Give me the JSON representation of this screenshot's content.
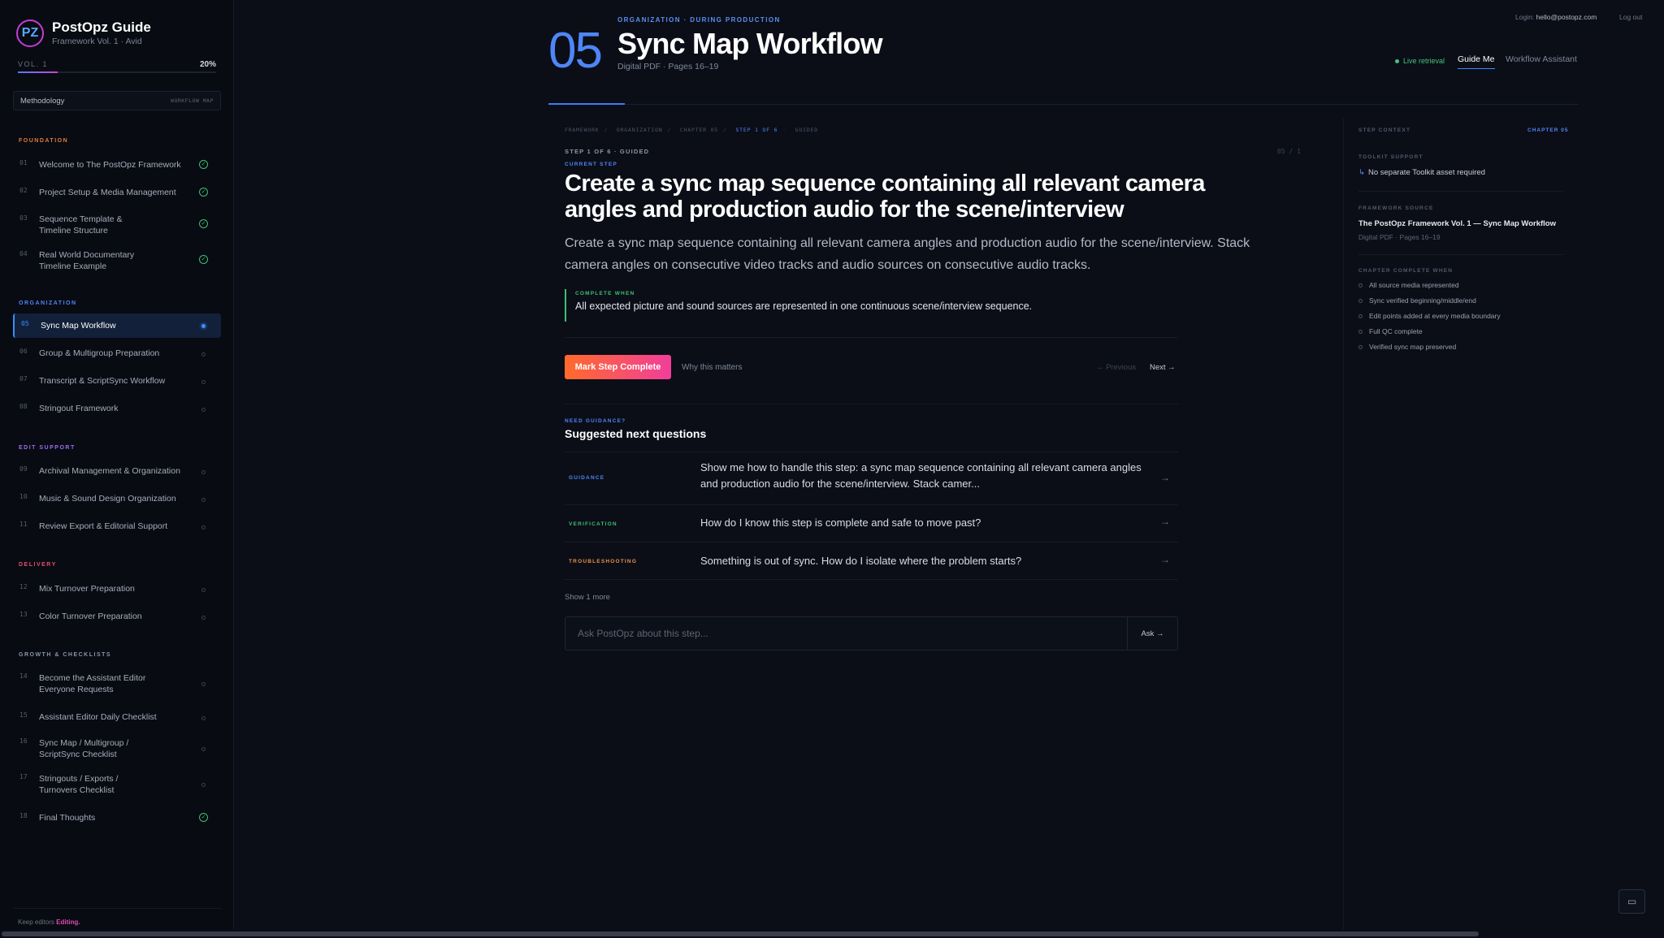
{
  "brand": {
    "logo_text": "PZ",
    "title": "PostOpz Guide",
    "subtitle": "Framework Vol. 1 · Avid"
  },
  "volume": {
    "label": "VOL. 1",
    "percent_text": "20%",
    "progress": 0.2
  },
  "methodology": {
    "label": "Methodology",
    "right": "WORKFLOW MAP"
  },
  "sections": [
    {
      "name": "FOUNDATION",
      "color": "#e27a3c"
    },
    {
      "name": "ORGANIZATION",
      "color": "#4f86f7"
    },
    {
      "name": "EDIT SUPPORT",
      "color": "#9b6cf2"
    },
    {
      "name": "DELIVERY",
      "color": "#e0506a"
    },
    {
      "name": "GROWTH & CHECKLISTS",
      "color": "#8d95a6"
    }
  ],
  "nav": [
    {
      "num": "01",
      "label": "Welcome to The PostOpz Framework",
      "status": "done"
    },
    {
      "num": "02",
      "label": "Project Setup & Media Management",
      "status": "done"
    },
    {
      "num": "03",
      "label": "Sequence Template & Timeline Structure",
      "status": "done"
    },
    {
      "num": "04",
      "label": "Real World Documentary Timeline Example",
      "status": "done"
    },
    {
      "num": "05",
      "label": "Sync Map Workflow",
      "status": "current"
    },
    {
      "num": "06",
      "label": "Group & Multigroup Preparation",
      "status": "todo"
    },
    {
      "num": "07",
      "label": "Transcript & ScriptSync Workflow",
      "status": "todo"
    },
    {
      "num": "08",
      "label": "Stringout Framework",
      "status": "todo"
    },
    {
      "num": "09",
      "label": "Archival Management & Organization",
      "status": "todo"
    },
    {
      "num": "10",
      "label": "Music & Sound Design Organization",
      "status": "todo"
    },
    {
      "num": "11",
      "label": "Review Export & Editorial Support",
      "status": "todo"
    },
    {
      "num": "12",
      "label": "Mix Turnover Preparation",
      "status": "todo"
    },
    {
      "num": "13",
      "label": "Color Turnover Preparation",
      "status": "todo"
    },
    {
      "num": "14",
      "label": "Become the Assistant Editor Everyone Requests",
      "status": "todo"
    },
    {
      "num": "15",
      "label": "Assistant Editor Daily Checklist",
      "status": "todo"
    },
    {
      "num": "16",
      "label": "Sync Map / Multigroup / ScriptSync Checklist",
      "status": "todo"
    },
    {
      "num": "17",
      "label": "Stringouts / Exports / Turnovers Checklist",
      "status": "todo"
    },
    {
      "num": "18",
      "label": "Final Thoughts",
      "status": "done"
    }
  ],
  "sidebar_footer": {
    "prefix": "Keep editors",
    "emphasis": "Editing."
  },
  "header": {
    "chapter_number": "05",
    "kicker": "ORGANIZATION · DURING PRODUCTION",
    "title": "Sync Map Workflow",
    "subtitle": "Digital PDF · Pages 16–19",
    "login_label": "Login:",
    "login_email": "hello@postopz.com",
    "logout": "Log out",
    "live": "Live retrieval",
    "tab_guide": "Guide Me",
    "tab_assistant": "Workflow Assistant"
  },
  "breadcrumb": [
    "FRAMEWORK",
    "ORGANIZATION",
    "CHAPTER 05",
    "STEP 1 OF 6",
    "GUIDED"
  ],
  "step": {
    "step_of": "STEP 1 OF 6 · GUIDED",
    "count": "05 / 1",
    "current_label": "CURRENT STEP",
    "title": "Create a sync map sequence containing all relevant camera angles and production audio for the scene/interview",
    "description": "Create a sync map sequence containing all relevant camera angles and production audio for the scene/interview. Stack camera angles on consecutive video tracks and audio sources on consecutive audio tracks.",
    "complete_when_label": "COMPLETE WHEN",
    "complete_when": "All expected picture and sound sources are represented in one continuous scene/interview sequence."
  },
  "actions": {
    "mark_complete": "Mark Step Complete",
    "why": "Why this matters",
    "previous": "← Previous",
    "next": "Next →"
  },
  "guidance": {
    "kicker": "NEED GUIDANCE?",
    "title": "Suggested next questions",
    "questions": [
      {
        "tag": "GUIDANCE",
        "color": "#4f86f7",
        "text": "Show me how to handle this step: a sync map sequence containing all relevant camera angles and production audio for the scene/interview. Stack camer..."
      },
      {
        "tag": "VERIFICATION",
        "color": "#3fbf74",
        "text": "How do I know this step is complete and safe to move past?"
      },
      {
        "tag": "TROUBLESHOOTING",
        "color": "#e8924a",
        "text": "Something is out of sync. How do I isolate where the problem starts?"
      }
    ],
    "show_more": "Show 1 more",
    "ask_placeholder": "Ask PostOpz about this step...",
    "ask_button": "Ask →"
  },
  "context": {
    "label": "STEP CONTEXT",
    "chapter": "CHAPTER 05",
    "toolkit_label": "TOOLKIT SUPPORT",
    "toolkit_value": "No separate Toolkit asset required",
    "source_label": "FRAMEWORK SOURCE",
    "source_title": "The PostOpz Framework Vol. 1 — Sync Map Workflow",
    "source_sub": "Digital PDF · Pages 16–19",
    "complete_label": "CHAPTER COMPLETE WHEN",
    "checklist": [
      "All source media represented",
      "Sync verified beginning/middle/end",
      "Edit points added at every media boundary",
      "Full QC complete",
      "Verified sync map preserved"
    ]
  }
}
